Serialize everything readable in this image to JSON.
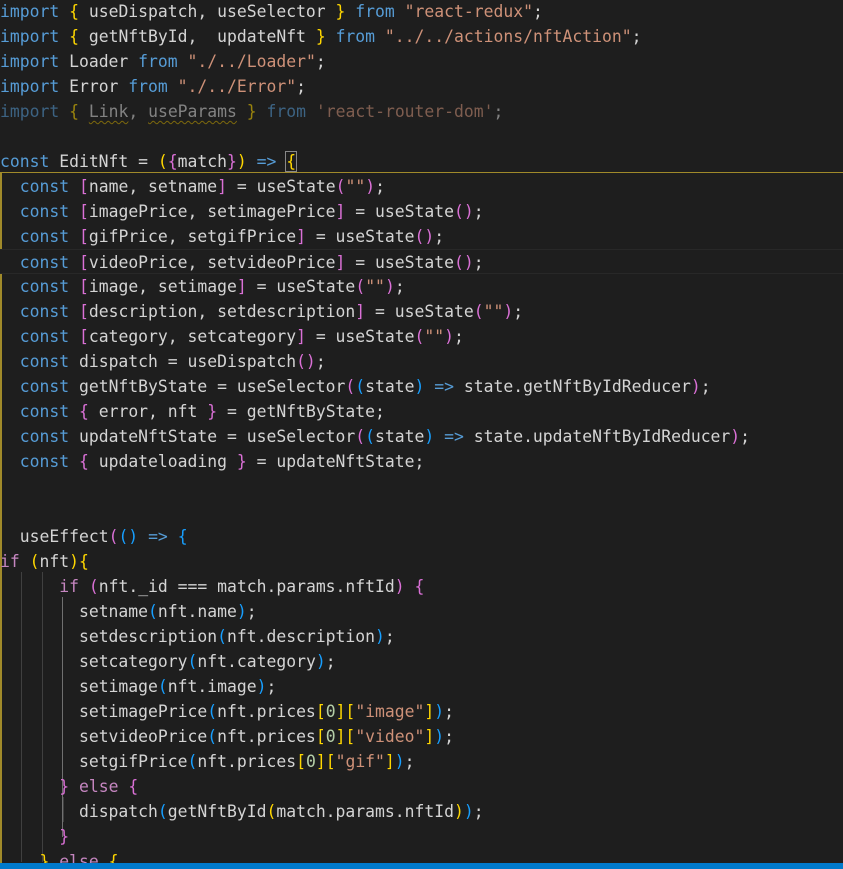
{
  "editor": {
    "language": "javascript",
    "cursor_line": 11,
    "lines": [
      {
        "tokens": [
          [
            "kw",
            "import"
          ],
          [
            "op",
            " "
          ],
          [
            "b1",
            "{"
          ],
          [
            "var",
            " useDispatch, useSelector "
          ],
          [
            "b1",
            "}"
          ],
          [
            "op",
            " "
          ],
          [
            "kw",
            "from"
          ],
          [
            "op",
            " "
          ],
          [
            "str",
            "\"react-redux\""
          ],
          [
            "op",
            ";"
          ]
        ]
      },
      {
        "tokens": [
          [
            "kw",
            "import"
          ],
          [
            "op",
            " "
          ],
          [
            "b1",
            "{"
          ],
          [
            "var",
            " getNftById,  updateNft "
          ],
          [
            "b1",
            "}"
          ],
          [
            "op",
            " "
          ],
          [
            "kw",
            "from"
          ],
          [
            "op",
            " "
          ],
          [
            "str",
            "\"../../actions/nftAction\""
          ],
          [
            "op",
            ";"
          ]
        ]
      },
      {
        "tokens": [
          [
            "kw",
            "import"
          ],
          [
            "var",
            " Loader "
          ],
          [
            "kw",
            "from"
          ],
          [
            "op",
            " "
          ],
          [
            "str",
            "\"./../Loader\""
          ],
          [
            "op",
            ";"
          ]
        ]
      },
      {
        "tokens": [
          [
            "kw",
            "import"
          ],
          [
            "var",
            " Error "
          ],
          [
            "kw",
            "from"
          ],
          [
            "op",
            " "
          ],
          [
            "str",
            "\"./../Error\""
          ],
          [
            "op",
            ";"
          ]
        ]
      },
      {
        "faded": true,
        "tokens": [
          [
            "kw",
            "import"
          ],
          [
            "op",
            " "
          ],
          [
            "b1",
            "{"
          ],
          [
            "op",
            " "
          ],
          [
            "var squiggle",
            "Link"
          ],
          [
            "op",
            ", "
          ],
          [
            "var squiggle",
            "useParams"
          ],
          [
            "op",
            " "
          ],
          [
            "b1",
            "}"
          ],
          [
            "op",
            " "
          ],
          [
            "kw",
            "from"
          ],
          [
            "op",
            " "
          ],
          [
            "str",
            "'react-router-dom'"
          ],
          [
            "op",
            ";"
          ]
        ]
      },
      {
        "tokens": []
      },
      {
        "tokens": [
          [
            "kw",
            "const"
          ],
          [
            "var",
            " EditNft = "
          ],
          [
            "b1",
            "("
          ],
          [
            "b2",
            "{"
          ],
          [
            "var",
            "match"
          ],
          [
            "b2",
            "}"
          ],
          [
            "b1",
            ")"
          ],
          [
            "op",
            " "
          ],
          [
            "kw",
            "=>"
          ],
          [
            "op",
            " "
          ],
          [
            "b1 bracket-match",
            "{"
          ]
        ]
      },
      {
        "tokens": [
          [
            "op",
            "  "
          ],
          [
            "kw",
            "const"
          ],
          [
            "op",
            " "
          ],
          [
            "b2",
            "["
          ],
          [
            "var",
            "name, setname"
          ],
          [
            "b2",
            "]"
          ],
          [
            "var",
            " = useState"
          ],
          [
            "b2",
            "("
          ],
          [
            "str",
            "\"\""
          ],
          [
            "b2",
            ")"
          ],
          [
            "op",
            ";"
          ]
        ]
      },
      {
        "tokens": [
          [
            "op",
            "  "
          ],
          [
            "kw",
            "const"
          ],
          [
            "op",
            " "
          ],
          [
            "b2",
            "["
          ],
          [
            "var",
            "imagePrice, setimagePrice"
          ],
          [
            "b2",
            "]"
          ],
          [
            "var",
            " = useState"
          ],
          [
            "b2",
            "()"
          ],
          [
            "op",
            ";"
          ]
        ]
      },
      {
        "tokens": [
          [
            "op",
            "  "
          ],
          [
            "kw",
            "const"
          ],
          [
            "op",
            " "
          ],
          [
            "b2",
            "["
          ],
          [
            "var",
            "gifPrice, setgifPrice"
          ],
          [
            "b2",
            "]"
          ],
          [
            "var",
            " = useState"
          ],
          [
            "b2",
            "()"
          ],
          [
            "op",
            ";"
          ]
        ]
      },
      {
        "tokens": [
          [
            "op",
            "  "
          ],
          [
            "kw",
            "const"
          ],
          [
            "op",
            " "
          ],
          [
            "b2",
            "["
          ],
          [
            "var",
            "videoPrice, setvideoPrice"
          ],
          [
            "b2",
            "]"
          ],
          [
            "var",
            " = useState"
          ],
          [
            "b2",
            "()"
          ],
          [
            "op",
            ";"
          ]
        ]
      },
      {
        "tokens": [
          [
            "op",
            "  "
          ],
          [
            "kw",
            "const"
          ],
          [
            "op",
            " "
          ],
          [
            "b2",
            "["
          ],
          [
            "var",
            "image, setimage"
          ],
          [
            "b2",
            "]"
          ],
          [
            "var",
            " = useState"
          ],
          [
            "b2",
            "("
          ],
          [
            "str",
            "\"\""
          ],
          [
            "b2",
            ")"
          ],
          [
            "op",
            ";"
          ]
        ]
      },
      {
        "tokens": [
          [
            "op",
            "  "
          ],
          [
            "kw",
            "const"
          ],
          [
            "op",
            " "
          ],
          [
            "b2",
            "["
          ],
          [
            "var",
            "description, setdescription"
          ],
          [
            "b2",
            "]"
          ],
          [
            "var",
            " = useState"
          ],
          [
            "b2",
            "("
          ],
          [
            "str",
            "\"\""
          ],
          [
            "b2",
            ")"
          ],
          [
            "op",
            ";"
          ]
        ]
      },
      {
        "tokens": [
          [
            "op",
            "  "
          ],
          [
            "kw",
            "const"
          ],
          [
            "op",
            " "
          ],
          [
            "b2",
            "["
          ],
          [
            "var",
            "category, setcategory"
          ],
          [
            "b2",
            "]"
          ],
          [
            "var",
            " = useState"
          ],
          [
            "b2",
            "("
          ],
          [
            "str",
            "\"\""
          ],
          [
            "b2",
            ")"
          ],
          [
            "op",
            ";"
          ]
        ]
      },
      {
        "tokens": [
          [
            "op",
            "  "
          ],
          [
            "kw",
            "const"
          ],
          [
            "var",
            " dispatch = useDispatch"
          ],
          [
            "b2",
            "()"
          ],
          [
            "op",
            ";"
          ]
        ]
      },
      {
        "tokens": [
          [
            "op",
            "  "
          ],
          [
            "kw",
            "const"
          ],
          [
            "var",
            " getNftByState = useSelector"
          ],
          [
            "b2",
            "("
          ],
          [
            "b3",
            "("
          ],
          [
            "var",
            "state"
          ],
          [
            "b3",
            ")"
          ],
          [
            "op",
            " "
          ],
          [
            "kw",
            "=>"
          ],
          [
            "var",
            " state.getNftByIdReducer"
          ],
          [
            "b2",
            ")"
          ],
          [
            "op",
            ";"
          ]
        ]
      },
      {
        "tokens": [
          [
            "op",
            "  "
          ],
          [
            "kw",
            "const"
          ],
          [
            "op",
            " "
          ],
          [
            "b2",
            "{"
          ],
          [
            "var",
            " error, nft "
          ],
          [
            "b2",
            "}"
          ],
          [
            "var",
            " = getNftByState;"
          ]
        ]
      },
      {
        "tokens": [
          [
            "op",
            "  "
          ],
          [
            "kw",
            "const"
          ],
          [
            "var",
            " updateNftState = useSelector"
          ],
          [
            "b2",
            "("
          ],
          [
            "b3",
            "("
          ],
          [
            "var",
            "state"
          ],
          [
            "b3",
            ")"
          ],
          [
            "op",
            " "
          ],
          [
            "kw",
            "=>"
          ],
          [
            "var",
            " state.updateNftByIdReducer"
          ],
          [
            "b2",
            ")"
          ],
          [
            "op",
            ";"
          ]
        ]
      },
      {
        "tokens": [
          [
            "op",
            "  "
          ],
          [
            "kw",
            "const"
          ],
          [
            "op",
            " "
          ],
          [
            "b2",
            "{"
          ],
          [
            "var",
            " updateloading "
          ],
          [
            "b2",
            "}"
          ],
          [
            "var",
            " = updateNftState;"
          ]
        ]
      },
      {
        "tokens": []
      },
      {
        "tokens": []
      },
      {
        "tokens": [
          [
            "op",
            "  "
          ],
          [
            "var",
            "useEffect"
          ],
          [
            "b2",
            "("
          ],
          [
            "b3",
            "()"
          ],
          [
            "op",
            " "
          ],
          [
            "kw",
            "=>"
          ],
          [
            "op",
            " "
          ],
          [
            "b3",
            "{"
          ]
        ]
      },
      {
        "tokens": [
          [
            "kw-ctl",
            "if"
          ],
          [
            "op",
            " "
          ],
          [
            "b1",
            "("
          ],
          [
            "var",
            "nft"
          ],
          [
            "b1",
            ")"
          ],
          [
            "b1",
            "{"
          ]
        ]
      },
      {
        "tokens": [
          [
            "op",
            "      "
          ],
          [
            "kw-ctl",
            "if"
          ],
          [
            "op",
            " "
          ],
          [
            "b2",
            "("
          ],
          [
            "var",
            "nft._id === match.params.nftId"
          ],
          [
            "b2",
            ")"
          ],
          [
            "op",
            " "
          ],
          [
            "b2",
            "{"
          ]
        ]
      },
      {
        "tokens": [
          [
            "op",
            "        "
          ],
          [
            "var",
            "setname"
          ],
          [
            "b3",
            "("
          ],
          [
            "var",
            "nft.name"
          ],
          [
            "b3",
            ")"
          ],
          [
            "op",
            ";"
          ]
        ]
      },
      {
        "tokens": [
          [
            "op",
            "        "
          ],
          [
            "var",
            "setdescription"
          ],
          [
            "b3",
            "("
          ],
          [
            "var",
            "nft.description"
          ],
          [
            "b3",
            ")"
          ],
          [
            "op",
            ";"
          ]
        ]
      },
      {
        "tokens": [
          [
            "op",
            "        "
          ],
          [
            "var",
            "setcategory"
          ],
          [
            "b3",
            "("
          ],
          [
            "var",
            "nft.category"
          ],
          [
            "b3",
            ")"
          ],
          [
            "op",
            ";"
          ]
        ]
      },
      {
        "tokens": [
          [
            "op",
            "        "
          ],
          [
            "var",
            "setimage"
          ],
          [
            "b3",
            "("
          ],
          [
            "var",
            "nft.image"
          ],
          [
            "b3",
            ")"
          ],
          [
            "op",
            ";"
          ]
        ]
      },
      {
        "tokens": [
          [
            "op",
            "        "
          ],
          [
            "var",
            "setimagePrice"
          ],
          [
            "b3",
            "("
          ],
          [
            "var",
            "nft.prices"
          ],
          [
            "b1",
            "["
          ],
          [
            "num",
            "0"
          ],
          [
            "b1",
            "]["
          ],
          [
            "str",
            "\"image\""
          ],
          [
            "b1",
            "]"
          ],
          [
            "b3",
            ")"
          ],
          [
            "op",
            ";"
          ]
        ]
      },
      {
        "tokens": [
          [
            "op",
            "        "
          ],
          [
            "var",
            "setvideoPrice"
          ],
          [
            "b3",
            "("
          ],
          [
            "var",
            "nft.prices"
          ],
          [
            "b1",
            "["
          ],
          [
            "num",
            "0"
          ],
          [
            "b1",
            "]["
          ],
          [
            "str",
            "\"video\""
          ],
          [
            "b1",
            "]"
          ],
          [
            "b3",
            ")"
          ],
          [
            "op",
            ";"
          ]
        ]
      },
      {
        "tokens": [
          [
            "op",
            "        "
          ],
          [
            "var",
            "setgifPrice"
          ],
          [
            "b3",
            "("
          ],
          [
            "var",
            "nft.prices"
          ],
          [
            "b1",
            "["
          ],
          [
            "num",
            "0"
          ],
          [
            "b1",
            "]["
          ],
          [
            "str",
            "\"gif\""
          ],
          [
            "b1",
            "]"
          ],
          [
            "b3",
            ")"
          ],
          [
            "op",
            ";"
          ]
        ]
      },
      {
        "tokens": [
          [
            "op",
            "      "
          ],
          [
            "b2",
            "}"
          ],
          [
            "op",
            " "
          ],
          [
            "kw-ctl",
            "else"
          ],
          [
            "op",
            " "
          ],
          [
            "b2",
            "{"
          ]
        ]
      },
      {
        "tokens": [
          [
            "op",
            "        "
          ],
          [
            "var",
            "dispatch"
          ],
          [
            "b3",
            "("
          ],
          [
            "var",
            "getNftById"
          ],
          [
            "b1",
            "("
          ],
          [
            "var",
            "match.params.nftId"
          ],
          [
            "b1",
            ")"
          ],
          [
            "b3",
            ")"
          ],
          [
            "op",
            ";"
          ]
        ]
      },
      {
        "tokens": [
          [
            "op",
            "      "
          ],
          [
            "b2",
            "}"
          ]
        ]
      },
      {
        "tokens": [
          [
            "op",
            "    "
          ],
          [
            "b1",
            "}"
          ],
          [
            "op",
            " "
          ],
          [
            "kw-ctl",
            "else"
          ],
          [
            "op",
            " "
          ],
          [
            "b1",
            "{"
          ]
        ]
      }
    ]
  },
  "colors": {
    "background": "#1e1e1e",
    "keyword": "#569cd6",
    "control": "#c586c0",
    "string": "#ce9178",
    "text": "#d4d4d4",
    "bracket1": "#ffd700",
    "bracket2": "#da70d6",
    "bracket3": "#179fff",
    "statusbar": "#007acc"
  }
}
